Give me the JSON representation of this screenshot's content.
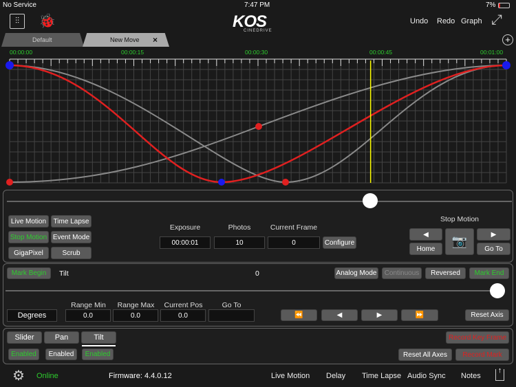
{
  "status": {
    "carrier": "No Service",
    "time": "7:47 PM",
    "battery": "7%"
  },
  "header": {
    "logo": "KOS",
    "logo_sub": "CINEDRIVE",
    "undo": "Undo",
    "redo": "Redo",
    "graph": "Graph"
  },
  "tabs": [
    {
      "label": "Default"
    },
    {
      "label": "New Move",
      "close": "×"
    }
  ],
  "timeline": {
    "ticks": [
      "00:00:00",
      "00:00:15",
      "00:00:30",
      "00:00:45",
      "00:01:00"
    ],
    "playhead_seconds": 43.6,
    "colors": {
      "tilt": "#e02020",
      "other": "#8a8a8a",
      "playhead": "#ffff00"
    }
  },
  "modes": {
    "live_motion": "Live Motion",
    "time_lapse": "Time Lapse",
    "stop_motion": "Stop Motion",
    "event_mode": "Event Mode",
    "gigapixel": "GigaPixel",
    "scrub": "Scrub"
  },
  "stop": {
    "exposure_label": "Exposure",
    "exposure": "00:00:01",
    "photos_label": "Photos",
    "photos": "10",
    "frame_label": "Current Frame",
    "frame": "0",
    "configure": "Configure",
    "title": "Stop Motion",
    "home": "Home",
    "goto": "Go To"
  },
  "axis": {
    "mark_begin": "Mark Begin",
    "name": "Tilt",
    "value": "0",
    "analog": "Analog Mode",
    "continuous": "Continuous",
    "reversed": "Reversed",
    "mark_end": "Mark End",
    "slider_value": 1.0,
    "units": "Degrees",
    "range_min_label": "Range Min",
    "range_min": "0.0",
    "range_max_label": "Range Max",
    "range_max": "0.0",
    "current_label": "Current Pos",
    "current": "0.0",
    "goto_label": "Go To",
    "goto": "",
    "reset": "Reset Axis"
  },
  "axes": {
    "items": [
      {
        "label": "Slider",
        "state": "Enabled"
      },
      {
        "label": "Pan",
        "state": "Enabled"
      },
      {
        "label": "Tilt",
        "state": "Enabled"
      }
    ],
    "record_key": "Record Key Frame",
    "reset_all": "Reset All Axes",
    "record_mark": "Record Mark"
  },
  "footer": {
    "status": "Online",
    "firmware": "Firmware: 4.4.0.12",
    "items": [
      "Live Motion",
      "Delay",
      "Time Lapse",
      "Audio Sync",
      "Notes"
    ]
  }
}
